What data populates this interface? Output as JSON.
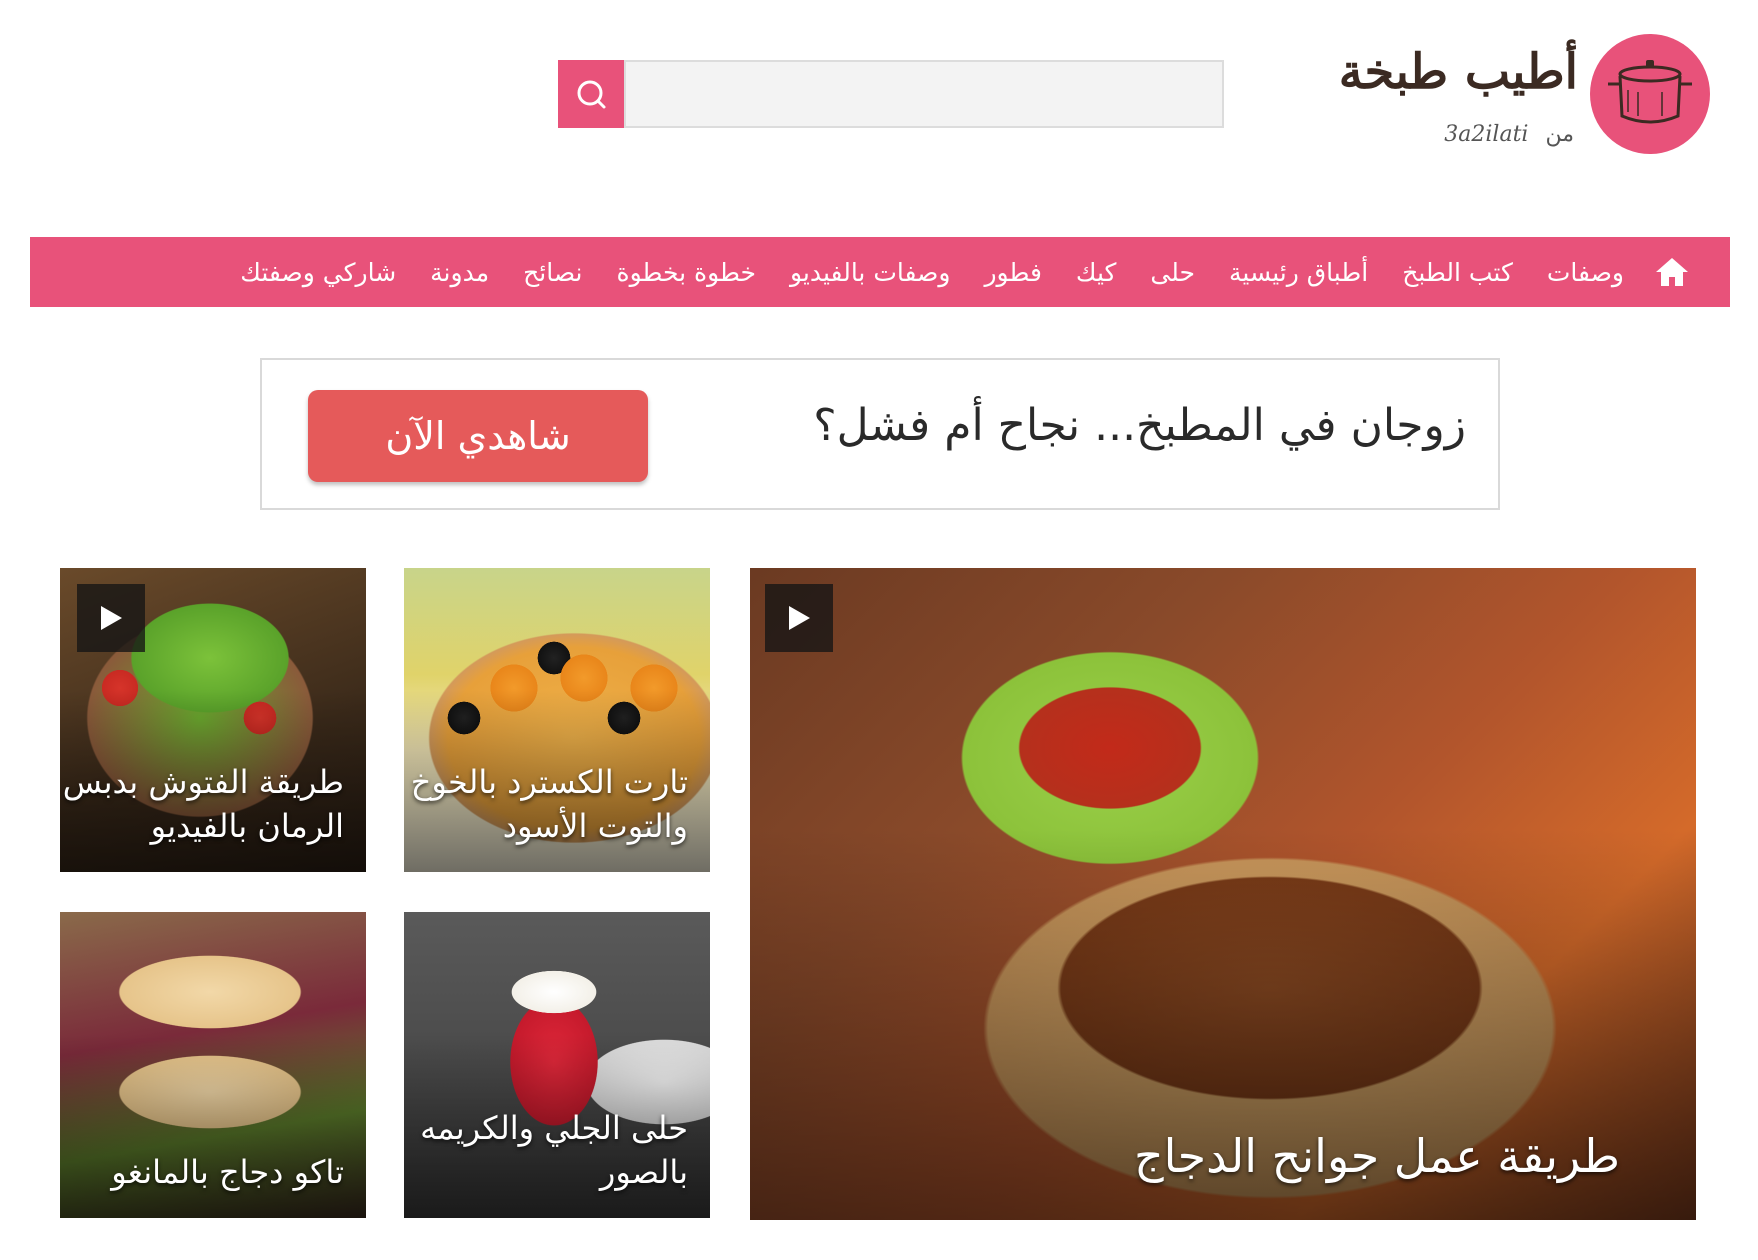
{
  "header": {
    "logo_title": "أطيب طبخة",
    "logo_from": "من",
    "logo_brand": "3a2ilati",
    "logo_icon": "cooking-pot-icon",
    "search": {
      "placeholder": "",
      "value": "",
      "icon": "search-icon"
    }
  },
  "nav": {
    "home_icon": "home-icon",
    "items": [
      {
        "label": "وصفات"
      },
      {
        "label": "كتب الطبخ"
      },
      {
        "label": "أطباق رئيسية"
      },
      {
        "label": "حلى"
      },
      {
        "label": "كيك"
      },
      {
        "label": "فطور"
      },
      {
        "label": "وصفات بالفيديو"
      },
      {
        "label": "خطوة بخطوة"
      },
      {
        "label": "نصائح"
      },
      {
        "label": "مدونة"
      },
      {
        "label": "شاركي وصفتك"
      }
    ]
  },
  "banner": {
    "text": "زوجان في المطبخ... نجاح أم فشل؟",
    "button_label": "شاهدي الآن"
  },
  "cards": {
    "featured": {
      "title": "طريقة عمل جوانح الدجاج",
      "has_video": true
    },
    "tart": {
      "title": "تارت الكسترد بالخوخ والتوت الأسود",
      "has_video": false
    },
    "fattoush": {
      "title": "طريقة الفتوش بدبس الرمان بالفيديو",
      "has_video": true
    },
    "jelly": {
      "title": "حلى الجلي والكريمه بالصور",
      "has_video": false
    },
    "taco": {
      "title": "تاكو دجاج بالمانغو",
      "has_video": false
    }
  },
  "colors": {
    "brand": "#e8527a",
    "banner_button": "#e55a5a"
  }
}
